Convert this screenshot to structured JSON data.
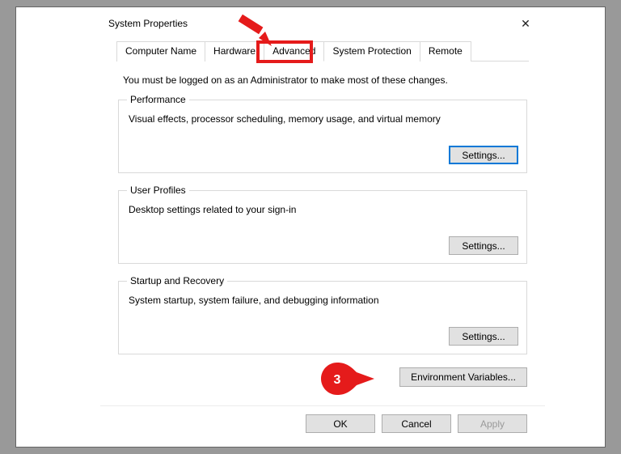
{
  "window": {
    "title": "System Properties",
    "close_glyph": "✕"
  },
  "tabs": {
    "computer_name": "Computer Name",
    "hardware": "Hardware",
    "advanced": "Advanced",
    "system_protection": "System Protection",
    "remote": "Remote",
    "active": "advanced"
  },
  "admin_note": "You must be logged on as an Administrator to make most of these changes.",
  "performance": {
    "legend": "Performance",
    "desc": "Visual effects, processor scheduling, memory usage, and virtual memory",
    "button": "Settings..."
  },
  "user_profiles": {
    "legend": "User Profiles",
    "desc": "Desktop settings related to your sign-in",
    "button": "Settings..."
  },
  "startup": {
    "legend": "Startup and Recovery",
    "desc": "System startup, system failure, and debugging information",
    "button": "Settings..."
  },
  "env_button": "Environment Variables...",
  "footer": {
    "ok": "OK",
    "cancel": "Cancel",
    "apply": "Apply"
  },
  "callouts": {
    "step_number": "3",
    "accent": "#e51b1b"
  }
}
